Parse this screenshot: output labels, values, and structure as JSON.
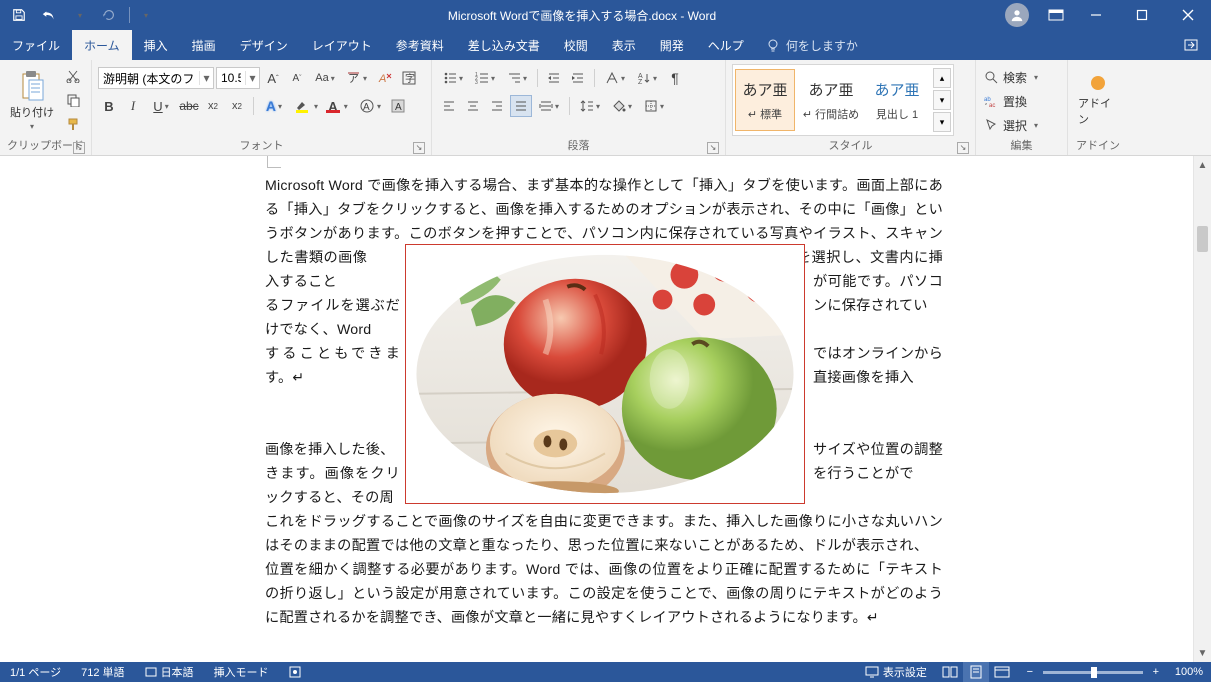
{
  "title": "Microsoft Wordで画像を挿入する場合.docx  -  Word",
  "tabs": {
    "file": "ファイル",
    "home": "ホーム",
    "insert": "挿入",
    "draw": "描画",
    "design": "デザイン",
    "layout": "レイアウト",
    "references": "参考資料",
    "mailings": "差し込み文書",
    "review": "校閲",
    "view": "表示",
    "dev": "開発",
    "help": "ヘルプ",
    "tellme": "何をしますか"
  },
  "ribbon": {
    "clipboard": {
      "label": "クリップボード",
      "paste": "貼り付け"
    },
    "font": {
      "label": "フォント",
      "name": "游明朝 (本文のフォン",
      "size": "10.5"
    },
    "paragraph": {
      "label": "段落"
    },
    "styles": {
      "label": "スタイル",
      "s1": {
        "sample": "あア亜",
        "name": "↵ 標準"
      },
      "s2": {
        "sample": "あア亜",
        "name": "↵ 行間詰め"
      },
      "s3": {
        "sample": "あア亜",
        "name": "見出し 1"
      }
    },
    "editing": {
      "label": "編集",
      "find": "検索",
      "replace": "置換",
      "select": "選択"
    },
    "addin": {
      "label": "アドイン",
      "btn": "アドイン"
    }
  },
  "document": {
    "p1a": "Microsoft Word で画像を挿入する場合、まず基本的な操作として「挿入」タブを使います。画面上部にある「挿入」タブをクリックすると、画像を挿入するためのオプションが表示され、その中に「画像」というボタンがあります。このボタンを押すことで、パソコン内に保存されている写真やイラスト、スキャンした書類の画像",
    "p1b": "などを選択し、文書内に挿入すること",
    "p1c": "が可能です。パソコンに保存されてい",
    "p1d": "るファイルを選ぶだけでなく、Word",
    "p1e": "ではオンラインから直接画像を挿入",
    "p1f": "することもできます。↵",
    "p2a": "画像を挿入した後、",
    "p2b": "サイズや位置の調整を行うことがで",
    "p2c": "きます。画像をクリックすると、その周",
    "p2d": "りに小さな丸いハンドルが表示され、",
    "p2e": "これをドラッグすることで画像のサイズを自由に変更できます。また、挿入した画像はそのままの配置では他の文章と重なったり、思った位置に来ないことがあるため、位置を細かく調整する必要があります。Word では、画像の位置をより正確に配置するために「テキストの折り返し」という設定が用意されています。この設定を使うことで、画像の周りにテキストがどのように配置されるかを調整でき、画像が文章と一緒に見やすくレイアウトされるようになります。↵"
  },
  "status": {
    "page": "1/1 ページ",
    "words": "712 単語",
    "lang": "日本語",
    "mode": "挿入モード",
    "display": "表示設定",
    "zoom": "100%"
  }
}
